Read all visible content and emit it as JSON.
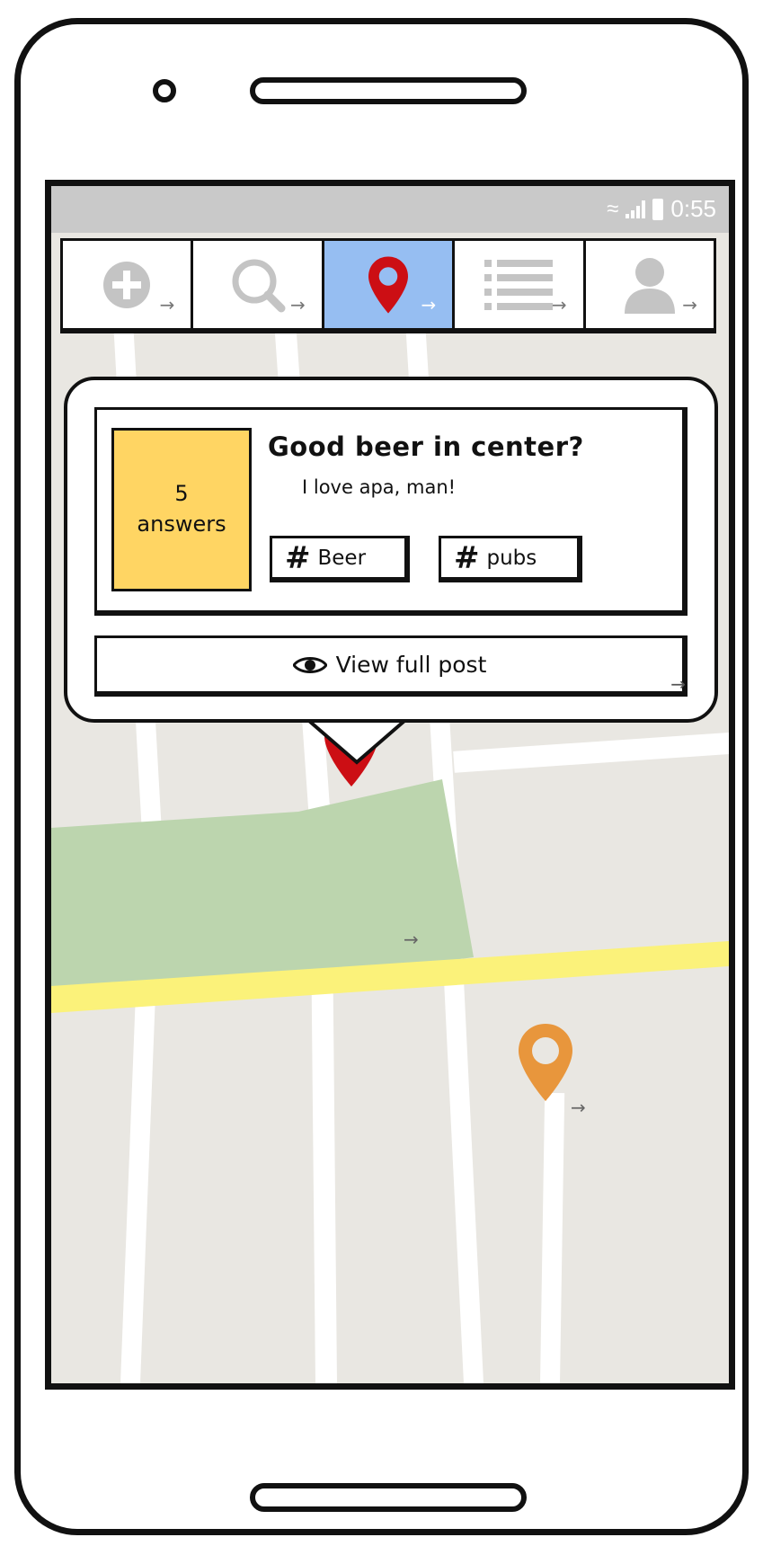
{
  "status_bar": {
    "time": "0:55",
    "wifi_icon": "wifi-icon",
    "signal_icon": "signal-icon",
    "battery_icon": "battery-icon"
  },
  "tabs": [
    {
      "icon": "add-circle-icon",
      "active": false
    },
    {
      "icon": "search-icon",
      "active": false
    },
    {
      "icon": "map-pin-icon",
      "active": true
    },
    {
      "icon": "list-icon",
      "active": false
    },
    {
      "icon": "user-icon",
      "active": false
    }
  ],
  "popup": {
    "answers_count": "5",
    "answers_label": "answers",
    "title": "Good beer in center?",
    "body": "I love apa, man!",
    "tags": [
      "Beer",
      "pubs"
    ],
    "tag_symbol": "#",
    "view_button": "View full post"
  },
  "map": {
    "selected_pin_color": "#cc0e14",
    "other_pin_color": "#e8963c",
    "park_color": "#bcd5ae",
    "highway_color": "#fbf27a",
    "land_color": "#e9e7e2"
  },
  "colors": {
    "active_tab": "#96bef2",
    "answers_bg": "#ffd563"
  }
}
